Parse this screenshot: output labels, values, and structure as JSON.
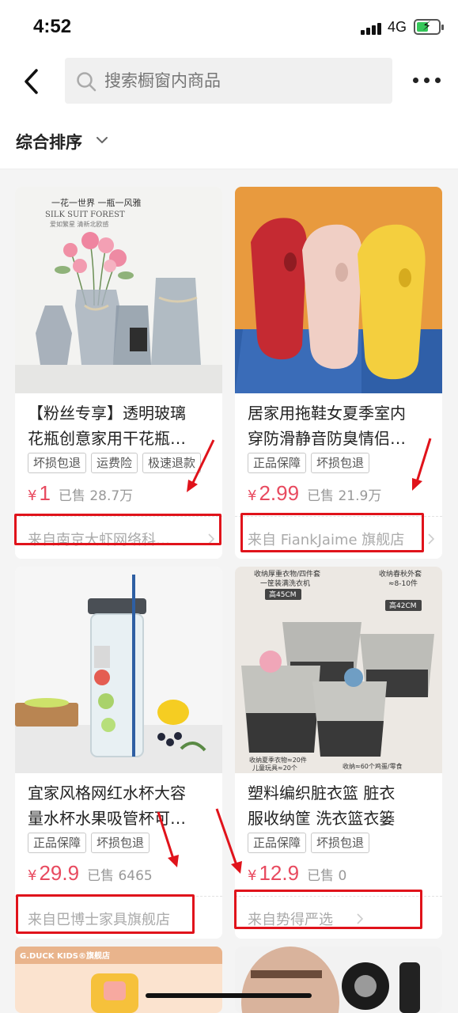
{
  "status": {
    "time": "4:52",
    "network": "4G"
  },
  "search": {
    "placeholder": "搜索橱窗内商品"
  },
  "sort": {
    "label": "综合排序"
  },
  "products": [
    {
      "title_line1": "【粉丝专享】透明玻璃",
      "title_line2": "花瓶创意家用干花瓶…",
      "tags": [
        "坏损包退",
        "运费险",
        "极速退款"
      ],
      "price_symbol": "¥",
      "price": "1",
      "sold": "已售 28.7万",
      "shop": "来自南京大虾网络科…",
      "image_caption": "一花一世界 一瓶一风雅",
      "image_brand": "SILK SUIT FOREST",
      "image_sub": "爱如繁星 清新北欧感"
    },
    {
      "title_line1": "居家用拖鞋女夏季室内",
      "title_line2": "穿防滑静音防臭情侣…",
      "tags": [
        "正品保障",
        "坏损包退"
      ],
      "price_symbol": "¥",
      "price": "2.99",
      "sold": "已售 21.9万",
      "shop": "来自 FiankJaime 旗舰店"
    },
    {
      "title_line1": "宜家风格网红水杯大容",
      "title_line2": "量水杯水果吸管杯可…",
      "tags": [
        "正品保障",
        "坏损包退"
      ],
      "price_symbol": "¥",
      "price": "29.9",
      "sold": "已售 6465",
      "shop": "来自巴博士家具旗舰店"
    },
    {
      "title_line1": "塑料编织脏衣篮 脏衣",
      "title_line2": "服收纳筐 洗衣篮衣篓",
      "tags": [
        "正品保障",
        "坏损包退"
      ],
      "price_symbol": "¥",
      "price": "12.9",
      "sold": "已售 0",
      "shop": "来自势得严选",
      "image_caption_a": "收纳厚重衣物/四件套",
      "image_caption_b": "一筐装满洗衣机",
      "image_caption_c": "收纳春秋外套",
      "image_caption_d": "≈8-10件",
      "image_size_a": "高45CM",
      "image_size_b": "高42CM",
      "image_bottom_a": "收纳夏季衣物≈20件",
      "image_bottom_b": "儿童玩具≈20个",
      "image_bottom_c": "收纳≈60个鸡蛋/零食"
    }
  ],
  "next_row": {
    "left_shop_badge": "G.DUCK KIDS®旗舰店"
  },
  "colors": {
    "price": "#e84a5f",
    "highlight": "#e0131b",
    "accent_battery": "#35c759"
  }
}
